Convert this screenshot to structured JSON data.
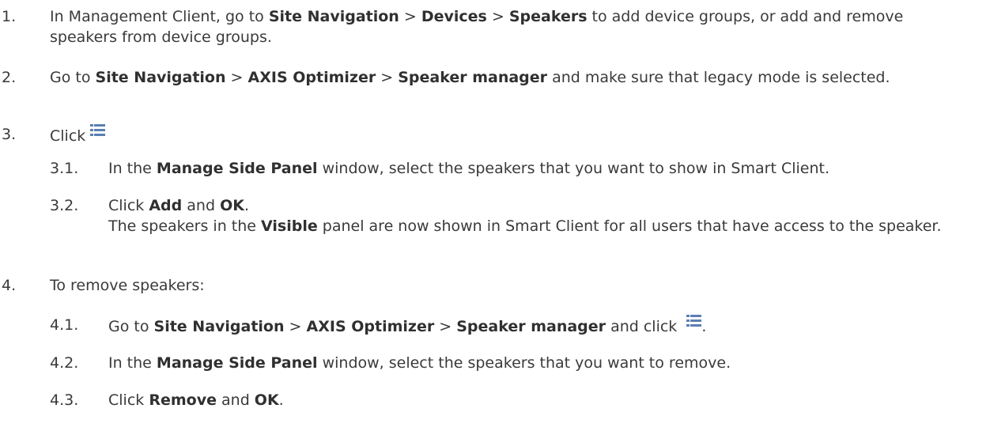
{
  "steps": [
    {
      "number": "1.",
      "parts": [
        "In Management Client, go to ",
        "Site Navigation",
        " > ",
        "Devices",
        " > ",
        "Speakers",
        " to add device groups, or add and remove speakers from device groups."
      ]
    },
    {
      "number": "2.",
      "parts": [
        "Go to ",
        "Site Navigation",
        " > ",
        "AXIS Optimizer",
        " > ",
        "Speaker manager",
        " and make sure that legacy mode is selected."
      ]
    },
    {
      "number": "3.",
      "parts": [
        "Click"
      ],
      "icon": "list-icon",
      "substeps": [
        {
          "number": "3.1.",
          "parts": [
            "In the ",
            "Manage Side Panel",
            " window, select the speakers that you want to show in Smart Client."
          ]
        },
        {
          "number": "3.2.",
          "parts": [
            "Click ",
            "Add",
            " and ",
            "OK",
            "."
          ],
          "result_parts": [
            "The speakers in the ",
            "Visible",
            " panel are now shown in Smart Client for all users that have access to the speaker."
          ]
        }
      ]
    },
    {
      "number": "4.",
      "parts": [
        "To remove speakers:"
      ],
      "substeps": [
        {
          "number": "4.1.",
          "parts": [
            "Go to ",
            "Site Navigation",
            " > ",
            "AXIS Optimizer",
            " > ",
            "Speaker manager",
            " and click ",
            "."
          ],
          "icon": "list-icon"
        },
        {
          "number": "4.2.",
          "parts": [
            "In the ",
            "Manage Side Panel",
            " window, select the speakers that you want to remove."
          ]
        },
        {
          "number": "4.3.",
          "parts": [
            "Click ",
            "Remove",
            " and ",
            "OK",
            "."
          ]
        }
      ]
    }
  ]
}
